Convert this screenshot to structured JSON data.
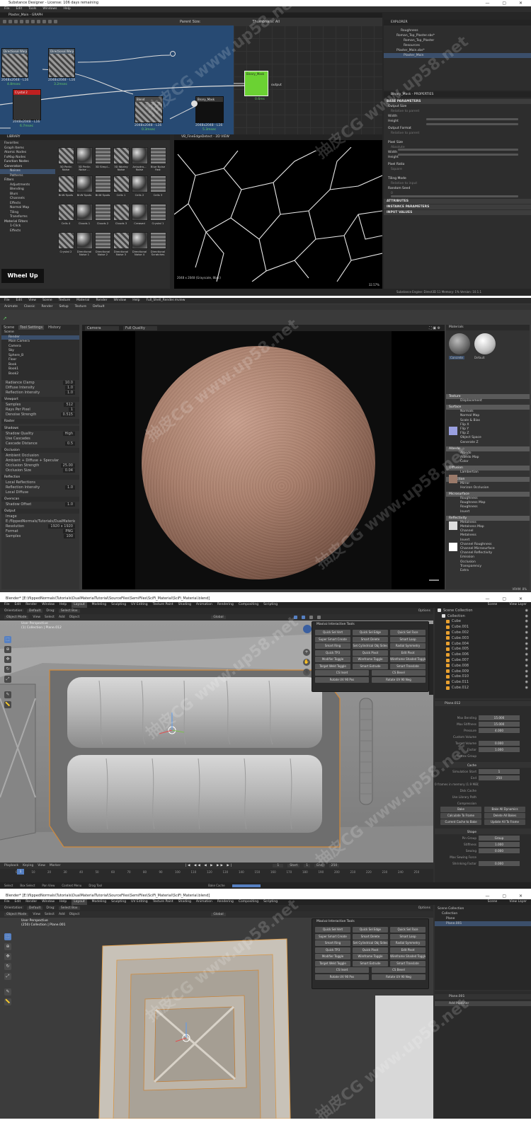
{
  "sd": {
    "title": "Substance Designer - License: 106 days remaining",
    "menu": [
      "File",
      "Edit",
      "Tools",
      "Windows",
      "Help"
    ],
    "graph_title": "Plaster_Main - GRAPH",
    "graph_toolbar": {
      "parent_size": "Parent Size:",
      "thumbnails": "Thumbnails: All"
    },
    "nodes": [
      {
        "name": "Directional Warp",
        "res": "2048x2048 - L16",
        "time": "4.8msec"
      },
      {
        "name": "Directional Warp",
        "res": "2048x2048 - L16",
        "time": "3.2msec"
      },
      {
        "name": "Crystal 2",
        "res": "2048x2048 - L16",
        "time": "6.7msec"
      },
      {
        "name": "Blend",
        "res": "2048x2048 - L16",
        "time": "0.3msec"
      },
      {
        "name": "Bnary_Mask",
        "res": "2048x2048 - L16",
        "time": "5.3msec"
      },
      {
        "name": "Binary_Mask",
        "res": "",
        "time": "0.6ms"
      }
    ],
    "output_label": "output",
    "explorer": {
      "title": "EXPLORER",
      "items": [
        "Roughness",
        "Roman_Top_Plaster.sbs*",
        "Roman_Top_Plaster",
        "Resources",
        "Plaster_Main.sbs*",
        "Plaster_Main"
      ]
    },
    "properties": {
      "title": "Binary_Mask - PROPERTIES",
      "sections": [
        "BASE PARAMETERS",
        "ATTRIBUTES",
        "INSTANCE PARAMETERS",
        "INPUT VALUES"
      ],
      "labels": [
        "Output Size",
        "Width",
        "Height",
        "Output Format",
        "Pixel Size",
        "Width",
        "Height",
        "Pixel Ratio",
        "Tiling Mode",
        "Random Seed"
      ],
      "values": [
        "Relative to parent",
        "0",
        "0",
        "Relative to parent",
        "Absolute",
        "Absolute",
        "Square",
        "Relative to input",
        "0"
      ]
    },
    "library": {
      "title": "LIBRARY",
      "tree": [
        "Favorites",
        "Graph Items",
        "Atomic Nodes",
        "FxMap Nodes",
        "Function Nodes",
        "Generators",
        "Noises",
        "Patterns",
        "Filters",
        "Adjustments",
        "Blending",
        "Blurs",
        "Channels",
        "Effects",
        "Normal Map",
        "Tiling",
        "Transforms",
        "Material Filters",
        "1-Click",
        "Effects"
      ],
      "thumbs": [
        "3D Perlin Noise",
        "3D Perlin Noise ...",
        "3D Simpl...",
        "3D Worley Noise",
        "Anisotro... Noise",
        "Blue Noise Fast",
        "BnW Spots",
        "BnW Spots",
        "BnW Spots",
        "Cells 1",
        "Cells 2",
        "Cells 3",
        "Cells 4",
        "Clouds 1",
        "Clouds 2",
        "Clouds 3",
        "Creased",
        "Crystal 1",
        "Crystal 2",
        "Directional Noise 1",
        "Directional Noise 2",
        "Directional Noise 3",
        "Directional Noise 4",
        "Directional Scratches"
      ],
      "badge": "Wheel Up"
    },
    "view2d": {
      "title": "VB_FineEdgeDetect - 2D VIEW",
      "footer": "2048 x 2048 (Grayscale, 8bpc)",
      "zoom": "32.57%"
    },
    "status": "Substance Engine: Direct3D 11  Memory: 1%  Version: 10.1.1"
  },
  "mm": {
    "menu": [
      "File",
      "Edit",
      "View",
      "Scene",
      "Texture",
      "Material",
      "Render",
      "Window",
      "Help"
    ],
    "menu2": [
      "Animate",
      "Classic",
      "Render",
      "Setup",
      "Texture",
      "Default"
    ],
    "file_title": "Full_Shell_Render.mview",
    "tabs": [
      "Scene",
      "Tool Settings",
      "History"
    ],
    "scene_tree": [
      "Scene",
      "Render",
      "Main Camera",
      "Camera",
      "Sky",
      "Sphere_B",
      "Floor",
      "Book",
      "Book1",
      "Book2"
    ],
    "settings": {
      "groups": [
        "Viewport",
        "Raster",
        "Shadows",
        "Occlusion",
        "Reflection",
        "Overscan",
        "Output"
      ],
      "items": [
        {
          "k": "Radiance Clamp",
          "v": "10.0"
        },
        {
          "k": "Diffuse Intensity",
          "v": "1.0"
        },
        {
          "k": "Reflection Intensity",
          "v": "1.0"
        },
        {
          "k": "Samples",
          "v": "512"
        },
        {
          "k": "Rays Per Pixel",
          "v": "1"
        },
        {
          "k": "Denoise Strength",
          "v": "0.515"
        },
        {
          "k": "Shadow Quality",
          "v": "High"
        },
        {
          "k": "Use Cascades",
          "v": ""
        },
        {
          "k": "Cascade Distance",
          "v": "0.5"
        },
        {
          "k": "Ambient Occlusion",
          "v": ""
        },
        {
          "k": "Ambient + Diffuse + Specular",
          "v": ""
        },
        {
          "k": "Occlusion Strength",
          "v": "25.00"
        },
        {
          "k": "Occlusion Size",
          "v": "0.04"
        },
        {
          "k": "Local Reflections",
          "v": ""
        },
        {
          "k": "Reflection Intensity",
          "v": "1.0"
        },
        {
          "k": "Local Diffuse",
          "v": ""
        },
        {
          "k": "Shadow Offset",
          "v": "1.0"
        },
        {
          "k": "Image",
          "v": ""
        },
        {
          "k": "E:/flippedNormals/Tutorials/DualMaterial",
          "v": ""
        },
        {
          "k": "Resolution",
          "v": "1920 x 1920"
        },
        {
          "k": "Format",
          "v": "PNG"
        },
        {
          "k": "Samples",
          "v": "100"
        }
      ]
    },
    "viewport": {
      "camera": "Camera",
      "quality": "Full Quality",
      "corner": "1 / 1"
    },
    "materials": {
      "title": "Materials",
      "names": [
        "Concrete",
        "Default"
      ]
    },
    "mat_props": {
      "sections": [
        "Texture",
        "Surface",
        "Albedo",
        "Diffusion",
        "Reflection",
        "Microsurface",
        "Reflectivity"
      ],
      "items": [
        "Displacement",
        "Normals",
        "Normal Map",
        "Scale & Bias",
        "Flip X",
        "Flip Y",
        "Flip Z",
        "Object Space",
        "Generate Z",
        "Albedo",
        "Albedo Map",
        "Color",
        "Lambertian",
        "Mirror",
        "Horizon Occlusion",
        "Roughness",
        "Roughness Map",
        "Roughness",
        "Invert",
        "Metalness",
        "Metalness Map",
        "Channel",
        "Metalness",
        "Invert",
        "Channel Roughness",
        "Channel Microsurface",
        "Channel Reflectivity",
        "Emission",
        "Occlusion",
        "Transparency",
        "Extra"
      ],
      "values": [
        "1.00",
        "R",
        "0.1"
      ]
    },
    "footer": "VRAM: 8%"
  },
  "bl1": {
    "title": "Blender* [E:\\flippedNormals\\Tutorials\\DualMaterialTutorial\\SourceFiles\\SemiFiles\\SciFi_Material\\SciFi_Material.blend]",
    "menu": [
      "File",
      "Edit",
      "Render",
      "Window",
      "Help",
      "Layout",
      "Modeling",
      "Sculpting",
      "UV Editing",
      "Texture Paint",
      "Shading",
      "Animation",
      "Rendering",
      "Compositing",
      "Scripting"
    ],
    "header": [
      "Object Mode",
      "View",
      "Select",
      "Add",
      "Object",
      "Global"
    ],
    "orient": "Orientation:",
    "default": "Default",
    "drag": "Drag:",
    "select_box": "Select Box",
    "options": "Options",
    "scene": "Scene",
    "view_layer": "View Layer",
    "view_label": "User Perspective",
    "view_sub": "(1) Collection | Plane.012",
    "popup_title": "Maxivz Interactive Tools",
    "popup": [
      "Quick Sel Vert",
      "Quick Sel Edge",
      "Quick Sel Face",
      "Super Smart Create",
      "Smart Delete",
      "Smart Loop",
      "Smart Ring",
      "Set Cylindrical Obj Sides",
      "Radial Symmetry",
      "Quick TP3",
      "Quick Pivot",
      "Edit Pivot",
      "Modifier Toggle",
      "Wireframe Toggle",
      "Wireframe Shaded Toggle",
      "Target Weld Toggle",
      "Smart Extrude",
      "Smart Translate",
      "CS Inset",
      "CS Bevel",
      "Rotate UV 90 Pos",
      "Rotate UV 90 Neg"
    ],
    "outliner": [
      "Scene Collection",
      "Collection",
      "Cube",
      "Cube.001",
      "Cube.002",
      "Cube.003",
      "Cube.004",
      "Cube.005",
      "Cube.006",
      "Cube.007",
      "Cube.008",
      "Cube.009",
      "Cube.010",
      "Cube.011",
      "Cube.012"
    ],
    "props": {
      "object": "Plane.012",
      "labels": [
        "Max Bending",
        "Max Stiffness",
        "Pressure",
        "Custom Volume",
        "Target Volume",
        "Factor",
        "Vertex Group",
        "Cache",
        "Simulation Start",
        "End",
        "0 frames in memory (1.9 MiB)",
        "Disk Cache",
        "Use Library Path",
        "Compression",
        "Bake",
        "Bake All Dynamics",
        "Calculate To Frame",
        "Delete All Bakes",
        "Current Cache to Bake",
        "Update All To Frame",
        "Shape",
        "Pin Group",
        "Stiffness",
        "Sewing",
        "Max Sewing Force",
        "Shrinking Factor"
      ],
      "values": [
        "15.000",
        "15.000",
        "4.000",
        "0.000",
        "1.000",
        "1",
        "250",
        "Group",
        "1.000",
        "0.000",
        "0.000"
      ]
    },
    "timeline": {
      "items": [
        "Playback",
        "Keying",
        "View",
        "Marker"
      ],
      "frame": "1",
      "start": "Start",
      "start_v": "1",
      "end": "End",
      "end_v": "250",
      "ticks": [
        "0",
        "10",
        "20",
        "30",
        "40",
        "50",
        "60",
        "70",
        "80",
        "90",
        "100",
        "110",
        "120",
        "130",
        "140",
        "150",
        "160",
        "170",
        "180",
        "190",
        "200",
        "210",
        "220",
        "230",
        "240",
        "250"
      ]
    },
    "status": [
      "Select",
      "Box Select",
      "Pan View",
      "Context Menu",
      "Drag Tool"
    ],
    "status_r": "Bake Cache"
  },
  "bl2": {
    "title": "Blender* [E:\\flippedNormals\\Tutorials\\DualMaterialTutorial\\SourceFiles\\SemiFiles\\SciFi_Material\\SciFi_Material.blend]",
    "view_label": "User Perspective",
    "view_sub": "(250) Collection | Plane.001",
    "outliner": [
      "Scene Collection",
      "Collection",
      "Plane",
      "Plane.001"
    ],
    "props": [
      "Plane.001",
      "Add Modifier"
    ]
  },
  "watermark": "抽皮CG www.up58.net"
}
